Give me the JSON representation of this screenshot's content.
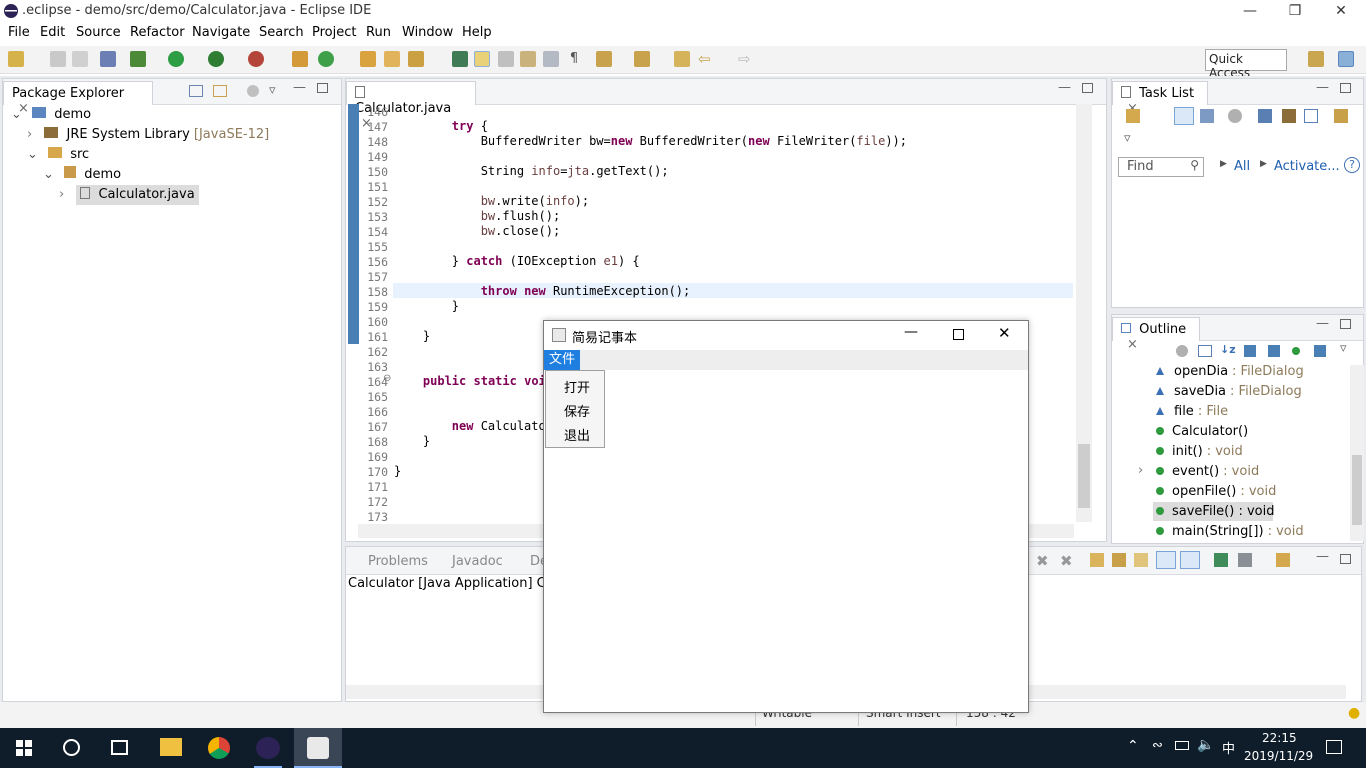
{
  "window": {
    "title": ".eclipse - demo/src/demo/Calculator.java - Eclipse IDE"
  },
  "menu": [
    "File",
    "Edit",
    "Source",
    "Refactor",
    "Navigate",
    "Search",
    "Project",
    "Run",
    "Window",
    "Help"
  ],
  "quick_access": "Quick Access",
  "package_explorer": {
    "tab": "Package Explorer",
    "project": "demo",
    "jre": "JRE System Library",
    "jre_version": "[JavaSE-12]",
    "src": "src",
    "package": "demo",
    "file": "Calculator.java"
  },
  "editor": {
    "tab": "Calculator.java",
    "lines": [
      {
        "n": "146",
        "html": ""
      },
      {
        "n": "147",
        "html": "        <span class=\"kw\">try</span> {"
      },
      {
        "n": "148",
        "html": "            BufferedWriter bw=<span class=\"kw\">new</span> BufferedWriter(<span class=\"kw\">new</span> FileWriter(<span class=\"var\">file</span>));"
      },
      {
        "n": "149",
        "html": ""
      },
      {
        "n": "150",
        "html": "            String <span class=\"var\">info</span>=<span class=\"var\">jta</span>.getText();"
      },
      {
        "n": "151",
        "html": ""
      },
      {
        "n": "152",
        "html": "            <span class=\"var\">bw</span>.write(<span class=\"var\">info</span>);"
      },
      {
        "n": "153",
        "html": "            <span class=\"var\">bw</span>.flush();"
      },
      {
        "n": "154",
        "html": "            <span class=\"var\">bw</span>.close();"
      },
      {
        "n": "155",
        "html": ""
      },
      {
        "n": "156",
        "html": "        } <span class=\"kw\">catch</span> (IOException <span class=\"var\">e1</span>) {"
      },
      {
        "n": "157",
        "html": ""
      },
      {
        "n": "158",
        "html": "            <span class=\"kw\">throw</span> <span class=\"kw\">new</span> RuntimeException();"
      },
      {
        "n": "159",
        "html": "        }"
      },
      {
        "n": "160",
        "html": ""
      },
      {
        "n": "161",
        "html": "    }"
      },
      {
        "n": "162",
        "html": ""
      },
      {
        "n": "163",
        "html": ""
      },
      {
        "n": "164",
        "html": "    <span class=\"kw\">public</span> <span class=\"kw\">static</span> <span class=\"kw\">void</span>"
      },
      {
        "n": "165",
        "html": ""
      },
      {
        "n": "166",
        "html": ""
      },
      {
        "n": "167",
        "html": "        <span class=\"kw\">new</span> Calculator"
      },
      {
        "n": "168",
        "html": "    }"
      },
      {
        "n": "169",
        "html": ""
      },
      {
        "n": "170",
        "html": "}"
      },
      {
        "n": "171",
        "html": ""
      },
      {
        "n": "172",
        "html": ""
      },
      {
        "n": "173",
        "html": ""
      }
    ]
  },
  "console": {
    "tabs": [
      "Problems",
      "Javadoc",
      "De"
    ],
    "text": "Calculator [Java Application] C:\\Pr"
  },
  "task_list": {
    "tab": "Task List",
    "find_placeholder": "Find",
    "all": "All",
    "activate": "Activate..."
  },
  "outline": {
    "tab": "Outline",
    "items": [
      {
        "kind": "field",
        "name": "openDia",
        "type": ": FileDialog"
      },
      {
        "kind": "field",
        "name": "saveDia",
        "type": ": FileDialog"
      },
      {
        "kind": "field",
        "name": "file",
        "type": ": File"
      },
      {
        "kind": "ctor",
        "name": "Calculator()",
        "type": ""
      },
      {
        "kind": "method",
        "name": "init()",
        "type": ": void"
      },
      {
        "kind": "method",
        "name": "event()",
        "type": ": void"
      },
      {
        "kind": "method",
        "name": "openFile()",
        "type": ": void"
      },
      {
        "kind": "method",
        "name": "saveFile() : void",
        "type": ""
      },
      {
        "kind": "method",
        "name": "main(String[])",
        "type": ": void"
      }
    ]
  },
  "status": {
    "writable": "Writable",
    "mode": "Smart Insert",
    "position": "158 : 42"
  },
  "dialog": {
    "title": "简易记事本",
    "menu_file": "文件",
    "items": [
      "打开",
      "保存",
      "退出"
    ]
  },
  "taskbar": {
    "time": "22:15",
    "date": "2019/11/29",
    "ime": "中"
  }
}
